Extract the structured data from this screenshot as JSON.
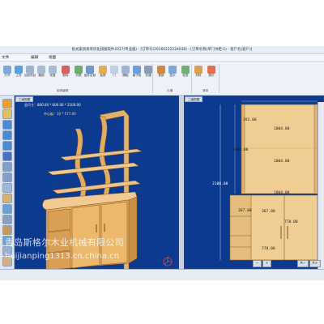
{
  "app": {
    "title": "板式家具拆单优化排版软件2017(专业版) - [订单号(20160222224038) - [订单名称(单门书柜-1) - 客户名(客户)]"
  },
  "menu": {
    "items": [
      "文件",
      "编辑",
      "视图"
    ]
  },
  "ribbon": {
    "buttons": [
      {
        "label": "打开",
        "icon": "open-icon",
        "color": "#7fa7d8"
      },
      {
        "label": "上传",
        "icon": "upload-icon",
        "color": "#5aa0e0"
      },
      {
        "label": "加到项目",
        "icon": "add-project-icon",
        "color": "#9cb4d0"
      },
      {
        "label": "撤销",
        "icon": "undo-icon",
        "color": "#a8bcd6"
      },
      {
        "label": "恢复",
        "icon": "redo-icon",
        "color": "#a8bcd6"
      },
      {
        "label": "删除",
        "icon": "delete-icon",
        "color": "#d86060"
      },
      {
        "label": "切角",
        "icon": "chamfer-icon",
        "color": "#70a870"
      },
      {
        "label": "板件定制",
        "icon": "panel-custom-icon",
        "color": "#6c98cc"
      },
      {
        "label": "抽屉",
        "icon": "drawer-icon",
        "color": "#e0b050"
      },
      {
        "label": "门",
        "icon": "door-icon",
        "color": "#c0cfe2"
      },
      {
        "label": "隔板",
        "icon": "shelf-icon",
        "color": "#9fb6d3"
      },
      {
        "label": "格子柜",
        "icon": "grid-cabinet-icon",
        "color": "#6aa0d8"
      },
      {
        "label": "衣通",
        "icon": "rail-icon",
        "color": "#8c9cb4"
      },
      {
        "label": "更新",
        "icon": "update-icon",
        "color": "#d08a40"
      },
      {
        "label": "显示",
        "icon": "display-icon",
        "color": "#7aa8d8"
      },
      {
        "label": "检查",
        "icon": "check-icon",
        "color": "#70b070"
      },
      {
        "label": "材料",
        "icon": "material-icon",
        "color": "#d8a050"
      },
      {
        "label": "报价",
        "icon": "quote-icon",
        "color": "#e07050"
      }
    ],
    "groups": [
      "家具编辑",
      "孔槽",
      "清单"
    ]
  },
  "left_tools": [
    {
      "icon": "material-swatch-icon",
      "color": "#e8a030"
    },
    {
      "icon": "palette-icon",
      "color": "#e0c060"
    },
    {
      "icon": "view-front-icon",
      "color": "#4a8ad0"
    },
    {
      "icon": "view-top-icon",
      "color": "#4a8ad0"
    },
    {
      "icon": "view-side-icon",
      "color": "#4a8ad0"
    },
    {
      "icon": "rotate-icon",
      "color": "#4a70c0"
    },
    {
      "icon": "zoom-icon",
      "color": "#80a0c8"
    },
    {
      "icon": "pan-icon",
      "color": "#80a0c8"
    },
    {
      "icon": "layer-icon",
      "color": "#a0b8d8"
    },
    {
      "icon": "box-icon",
      "color": "#d8b070"
    },
    {
      "icon": "grid-icon",
      "color": "#6a9fd6"
    },
    {
      "icon": "wire-icon",
      "color": "#88a0c0"
    },
    {
      "icon": "shade-icon",
      "color": "#c89858"
    },
    {
      "icon": "export-icon",
      "color": "#70a0d0"
    },
    {
      "icon": "settings-icon",
      "color": "#9ab0cc"
    },
    {
      "icon": "ruler-icon",
      "color": "#d0b080"
    }
  ],
  "view3d": {
    "tab_label": "三维视图",
    "info_line1": "总尺寸：800.00 * 600.00 * 2100.00",
    "info_line2": "中心板：10 * 577.00"
  },
  "view2d": {
    "tab_label": "二维视图",
    "dimensions": {
      "top_left": "392.00",
      "top_width": "1004.00",
      "left_height": "2100.00",
      "center_label": "1004.00",
      "cut_label": "1004.00",
      "mid_width": "1004.00",
      "low_left": "367.00",
      "low_left2": "367.00",
      "low_mid": "778.00",
      "low_mid2": "778.00"
    }
  },
  "zoom": {
    "minus": "−",
    "plus": "+",
    "a_minus": "A−",
    "a_plus": "A+"
  },
  "watermark": {
    "line1": "青岛斯格尔木业机械有限公司",
    "line2": "huijianping1313.cn.china.cn"
  },
  "colors": {
    "viewport_bg": "#0c3a8f",
    "wood": "#e8b868",
    "wood_dark": "#c98c3a",
    "panel": "#f2ce94"
  }
}
